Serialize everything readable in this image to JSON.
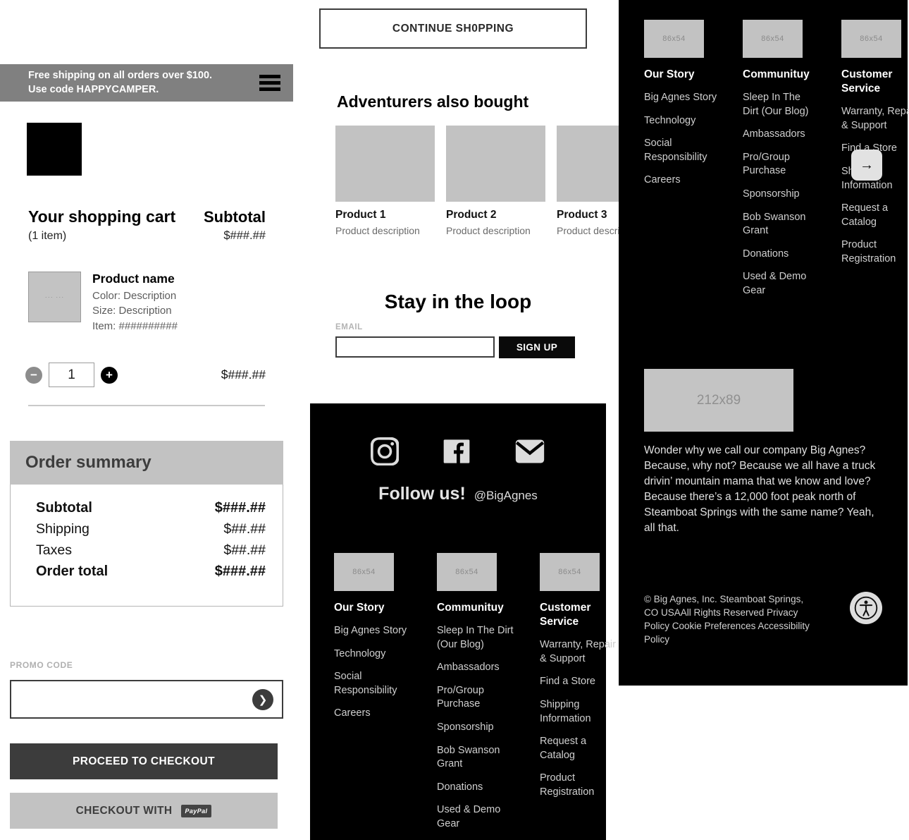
{
  "cart": {
    "promo_banner": {
      "text": "Free shipping on all orders over $100.\nUse code HAPPYCAMPER.",
      "menu_icon": "hamburger-menu-icon"
    },
    "title": "Your shopping cart",
    "subtotal_label": "Subtotal",
    "item_count": "(1 item)",
    "subtotal_value": "$###.##",
    "line_item": {
      "thumb_placeholder": "product-thumbnail",
      "name": "Product name",
      "color": "Color: Description",
      "size": "Size: Description",
      "item_number": "Item: ##########",
      "quantity": "1",
      "decrease_label": "−",
      "increase_label": "+",
      "price": "$###.##"
    },
    "order_summary": {
      "heading": "Order summary",
      "rows": [
        {
          "label": "Subtotal",
          "value": "$###.##",
          "bold": true
        },
        {
          "label": "Shipping",
          "value": "$##.##",
          "bold": false
        },
        {
          "label": "Taxes",
          "value": "$##.##",
          "bold": false
        },
        {
          "label": "Order total",
          "value": "$###.##",
          "bold": true
        }
      ]
    },
    "promo_code": {
      "label": "PROMO CODE",
      "value": "",
      "placeholder": "",
      "submit_icon": "chevron-right-icon"
    },
    "checkout_button": "PROCEED TO CHECKOUT",
    "paypal_button": "CHECKOUT WITH",
    "paypal_logo": "PayPal"
  },
  "middle": {
    "continue_shopping": "CONTINUE SH0PPING",
    "recommendations": {
      "title": "Adventurers also bought",
      "next_icon": "arrow-right-icon",
      "cards": [
        {
          "title": "Product 1",
          "desc": "Product description"
        },
        {
          "title": "Product 2",
          "desc": "Product description"
        },
        {
          "title": "Product 3",
          "desc": "Product description"
        }
      ]
    },
    "newsletter": {
      "title": "Stay in the loop",
      "email_label": "EMAIL",
      "email_value": "",
      "email_placeholder": "",
      "signup_button": "SIGN UP"
    },
    "footer": {
      "social": {
        "instagram_icon": "instagram-icon",
        "facebook_icon": "facebook-icon",
        "email_icon": "envelope-icon",
        "follow_text": "Follow us!",
        "handle": "@BigAgnes"
      },
      "columns": [
        {
          "image_placeholder": "86x54",
          "heading": "Our Story",
          "links": [
            "Big Agnes Story",
            "Technology",
            "Social Responsibility",
            "Careers"
          ]
        },
        {
          "image_placeholder": "86x54",
          "heading": "Communituy",
          "links": [
            "Sleep In The Dirt (Our Blog)",
            "Ambassadors",
            "Pro/Group Purchase",
            "Sponsorship",
            "Bob Swanson Grant",
            "Donations",
            "Used & Demo Gear"
          ]
        },
        {
          "image_placeholder": "86x54",
          "heading": "Customer Service",
          "links": [
            "Warranty, Repair & Support",
            "Find a Store",
            "Shipping Information",
            "Request a Catalog",
            "Product Registration"
          ]
        }
      ]
    }
  },
  "right": {
    "columns": [
      {
        "image_placeholder": "86x54",
        "heading": "Our Story",
        "links": [
          "Big Agnes Story",
          "Technology",
          "Social Responsibility",
          "Careers"
        ]
      },
      {
        "image_placeholder": "86x54",
        "heading": "Communituy",
        "links": [
          "Sleep In The Dirt (Our Blog)",
          "Ambassadors",
          "Pro/Group Purchase",
          "Sponsorship",
          "Bob Swanson Grant",
          "Donations",
          "Used & Demo Gear"
        ]
      },
      {
        "image_placeholder": "86x54",
        "heading": "Customer Service",
        "links": [
          "Warranty, Repair & Support",
          "Find a Store",
          "Shipping Information",
          "Request a Catalog",
          "Product Registration"
        ]
      }
    ],
    "photo_placeholder": "212x89",
    "about_text": "Wonder why we call our company Big Agnes? Because, why not? Because we all have a truck drivin’ mountain mama that we know and love? Because there’s a 12,000 foot peak north of Steamboat Springs with the same name? Yeah, all that.",
    "copyright": "© Big Agnes, Inc. Steamboat Springs, CO USAAll Rights Reserved  Privacy Policy  Cookie Preferences Accessibility Policy",
    "accessibility_icon": "accessibility-icon"
  },
  "colors": {
    "banner_gray": "#808080",
    "dark_button": "#3c3c3c",
    "light_gray": "#c2c2c2",
    "footer_black": "#000000",
    "muted_text": "#6b6b6b"
  }
}
